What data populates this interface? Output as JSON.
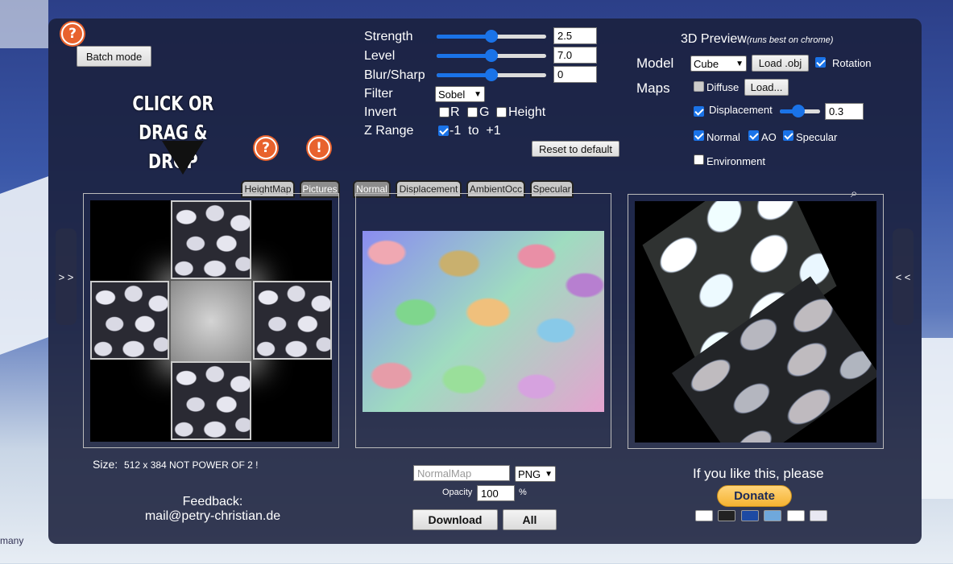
{
  "background": {
    "footer_fragment": "many"
  },
  "header": {
    "batch_mode_label": "Batch mode",
    "help_glyph": "?",
    "warn_glyph": "!",
    "drop_hint_line1": "CLICK OR",
    "drop_hint_line2": "DRAG & DROP"
  },
  "controls": {
    "strength": {
      "label": "Strength",
      "value": "2.5",
      "level": 0.5
    },
    "level": {
      "label": "Level",
      "value": "7.0",
      "level": 0.5
    },
    "blur": {
      "label": "Blur/Sharp",
      "value": "0",
      "level": 0.5
    },
    "filter": {
      "label": "Filter",
      "selected": "Sobel"
    },
    "invert": {
      "label": "Invert",
      "r": "R",
      "g": "G",
      "height": "Height"
    },
    "zrange": {
      "label": "Z Range",
      "value": "-1  to  +1"
    },
    "reset_label": "Reset to default"
  },
  "preview3d": {
    "title": "3D Preview",
    "note": "(runs best on chrome)",
    "model_label": "Model",
    "model_selected": "Cube",
    "load_obj_label": "Load .obj",
    "rotation_label": "Rotation",
    "maps_label": "Maps",
    "diffuse_label": "Diffuse",
    "load_label": "Load...",
    "displacement_label": "Displacement",
    "displacement_value": "0.3",
    "displacement_level": 0.45,
    "normal_label": "Normal",
    "ao_label": "AO",
    "specular_label": "Specular",
    "environment_label": "Environment"
  },
  "tabs_left": [
    "HeightMap",
    "Pictures"
  ],
  "tabs_mid": [
    "Normal",
    "Displacement",
    "AmbientOcc",
    "Specular"
  ],
  "side": {
    "open_left": "> >",
    "open_right": "< <"
  },
  "info": {
    "size_label": "Size:",
    "size_value": "512 x 384 NOT POWER OF 2 !",
    "feedback_label": "Feedback:",
    "feedback_email": "mail@petry-christian.de"
  },
  "export": {
    "filename_placeholder": "NormalMap",
    "format_selected": "PNG",
    "opacity_label": "Opacity",
    "opacity_value": "100",
    "percent": "%",
    "download_label": "Download",
    "all_label": "All"
  },
  "donate": {
    "text": "If you like this, please",
    "button_label": "Donate"
  },
  "colors": {
    "accent": "#1a73e8",
    "help": "#e8622d",
    "panel": "#1a203c"
  }
}
